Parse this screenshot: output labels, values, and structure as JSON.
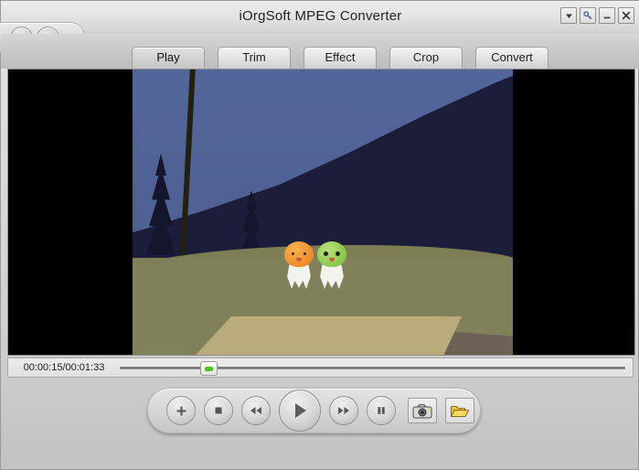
{
  "window": {
    "title": "iOrgSoft MPEG Converter",
    "controls": [
      {
        "name": "dropdown-button",
        "icon": "chevron-down-icon",
        "label": "Menu"
      },
      {
        "name": "register-button",
        "icon": "key-icon",
        "label": "Register"
      },
      {
        "name": "minimize-button",
        "icon": "minimize-icon",
        "label": "Minimize"
      },
      {
        "name": "close-button",
        "icon": "close-icon",
        "label": "Close"
      }
    ],
    "nav": [
      {
        "name": "back-button",
        "icon": "arrow-left-icon",
        "label": "Back"
      },
      {
        "name": "forward-button",
        "icon": "arrow-right-icon",
        "label": "Forward"
      }
    ]
  },
  "tabs": [
    {
      "label": "Play",
      "active": true
    },
    {
      "label": "Trim",
      "active": false
    },
    {
      "label": "Effect",
      "active": false
    },
    {
      "label": "Crop",
      "active": false
    },
    {
      "label": "Convert",
      "active": false
    }
  ],
  "player": {
    "time_display": "00:00:15/00:01:33",
    "elapsed": "00:00:15",
    "duration": "00:01:33",
    "progress_percent": 16,
    "thumb_color": "#4ec324"
  },
  "preview": {
    "letterbox_color": "#000000",
    "sky_color": "#4e6091",
    "hill_color": "#1b1d3a",
    "ground_color": "#7e7e55",
    "blanket_color": "#b9ab7c",
    "path_color": "#6d6055",
    "characters": [
      {
        "name": "orange-character",
        "head_color": "#ef8a2e"
      },
      {
        "name": "green-character",
        "head_color": "#8cc84b"
      }
    ]
  },
  "transport": [
    {
      "name": "add-file-button",
      "icon": "plus-icon",
      "label": "Add"
    },
    {
      "name": "stop-button",
      "icon": "stop-icon",
      "label": "Stop"
    },
    {
      "name": "rewind-button",
      "icon": "rewind-icon",
      "label": "Rewind"
    },
    {
      "name": "play-button",
      "icon": "play-icon",
      "label": "Play"
    },
    {
      "name": "forward-button",
      "icon": "fast-forward-icon",
      "label": "Fast Forward"
    },
    {
      "name": "pause-button",
      "icon": "pause-icon",
      "label": "Pause"
    },
    {
      "name": "snapshot-button",
      "icon": "camera-icon",
      "label": "Snapshot"
    },
    {
      "name": "open-folder-button",
      "icon": "folder-open-icon",
      "label": "Open Folder"
    }
  ]
}
